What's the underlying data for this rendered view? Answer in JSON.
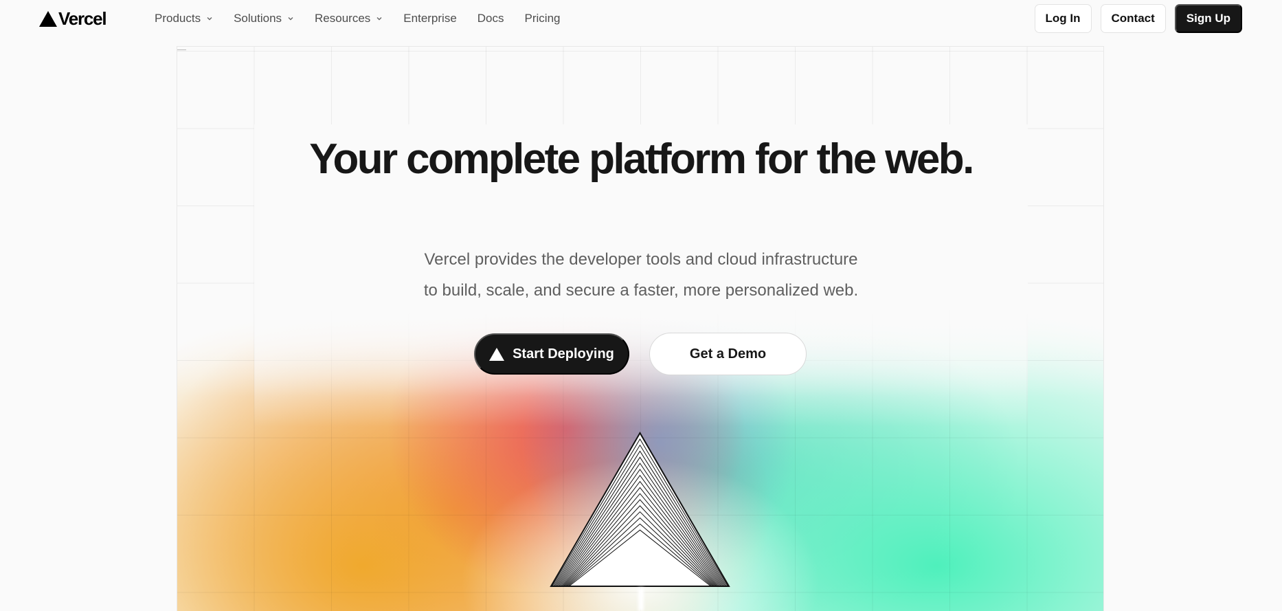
{
  "brand": {
    "name": "Vercel",
    "logo_icon": "vercel-triangle-icon"
  },
  "nav": {
    "items": [
      {
        "label": "Products",
        "has_dropdown": true
      },
      {
        "label": "Solutions",
        "has_dropdown": true
      },
      {
        "label": "Resources",
        "has_dropdown": true
      },
      {
        "label": "Enterprise",
        "has_dropdown": false
      },
      {
        "label": "Docs",
        "has_dropdown": false
      },
      {
        "label": "Pricing",
        "has_dropdown": false
      }
    ],
    "login_label": "Log In",
    "contact_label": "Contact",
    "signup_label": "Sign Up"
  },
  "hero": {
    "title": "Your complete platform for the web.",
    "subtitle_line1": "Vercel provides the developer tools and cloud infrastructure",
    "subtitle_line2": "to build, scale, and secure a faster, more personalized web.",
    "primary_cta": {
      "label": "Start Deploying",
      "icon": "vercel-triangle-icon"
    },
    "secondary_cta": {
      "label": "Get a Demo"
    },
    "illustration": "prism-triangle-icon"
  },
  "colors": {
    "background": "#fafafa",
    "text": "#171717",
    "muted_text": "#5f5f5f",
    "dark_button": "#171717",
    "gradient_orange": "#f0a828",
    "gradient_red": "#ee4850",
    "gradient_blue": "#7d9bcd",
    "gradient_green": "#46f0b9"
  }
}
